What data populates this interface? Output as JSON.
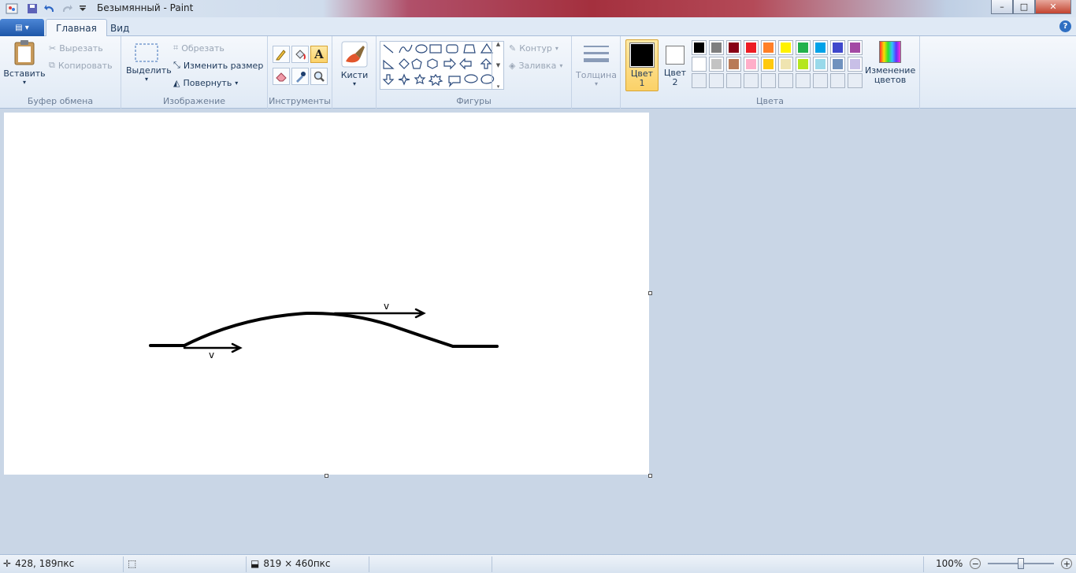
{
  "window": {
    "title": "Безымянный - Paint",
    "controls": {
      "minimize": "–",
      "maximize": "□",
      "close": "✕"
    }
  },
  "tabs": [
    {
      "label": "Главная",
      "active": true
    },
    {
      "label": "Вид",
      "active": false
    }
  ],
  "ribbon": {
    "clipboard": {
      "label": "Буфер обмена",
      "paste": "Вставить",
      "cut": "Вырезать",
      "copy": "Копировать"
    },
    "image": {
      "label": "Изображение",
      "select": "Выделить",
      "crop": "Обрезать",
      "resize": "Изменить размер",
      "rotate": "Повернуть"
    },
    "tools": {
      "label": "Инструменты"
    },
    "brushes": {
      "label": "Кисти"
    },
    "shapes": {
      "label": "Фигуры",
      "outline": "Контур",
      "fill": "Заливка"
    },
    "size": {
      "label": "Толщина"
    },
    "colors": {
      "label": "Цвета",
      "color1": "Цвет 1",
      "color2": "Цвет 2",
      "edit": "Изменение цветов",
      "color1_value": "#000000",
      "color2_value": "#ffffff",
      "palette_row1": [
        "#000000",
        "#7f7f7f",
        "#880015",
        "#ed1c24",
        "#ff7f27",
        "#fff200",
        "#22b14c",
        "#00a2e8",
        "#3f48cc",
        "#a349a4"
      ],
      "palette_row2": [
        "#ffffff",
        "#c3c3c3",
        "#b97a57",
        "#ffaec9",
        "#ffc90e",
        "#efe4b0",
        "#b5e61d",
        "#99d9ea",
        "#7092be",
        "#c8bfe7"
      ]
    }
  },
  "canvas": {
    "labels": {
      "v1": "v",
      "v2": "v"
    }
  },
  "status": {
    "cursor": "428, 189пкс",
    "size": "819 × 460пкс",
    "zoom": "100%"
  }
}
